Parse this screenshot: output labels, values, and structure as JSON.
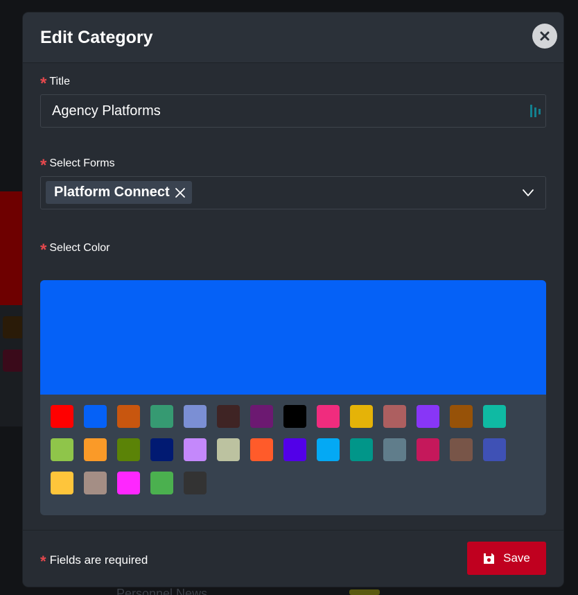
{
  "modal": {
    "title": "Edit Category"
  },
  "icons": {
    "close": "close-icon",
    "required": "asterisk",
    "password_manager": "lastpass-icon",
    "dropdown": "chevron-down-icon",
    "tag_remove": "x-icon",
    "save": "floppy-disk-icon"
  },
  "form": {
    "required_mark": "*",
    "title": {
      "label": "Title",
      "value": "Agency Platforms"
    },
    "forms": {
      "label": "Select Forms",
      "selected": [
        "Platform Connect"
      ]
    },
    "color": {
      "label": "Select Color",
      "selected": "#0561f7",
      "swatches": [
        "#ff0000",
        "#0561f7",
        "#c8560f",
        "#369a72",
        "#7b8fd4",
        "#3f2424",
        "#6c1971",
        "#000000",
        "#f02c7e",
        "#e5b308",
        "#ad5f60",
        "#8836f7",
        "#975208",
        "#0fbaa3",
        "#8fc54a",
        "#fa9a28",
        "#5b8307",
        "#011a72",
        "#c488fb",
        "#bcc2a0",
        "#ff5b2a",
        "#5200e8",
        "#04a9f4",
        "#019689",
        "#607d8b",
        "#c5185b",
        "#785548",
        "#3f51b5",
        "#fec53b",
        "#a48e85",
        "#fe27fe",
        "#4bb04f",
        "#333333"
      ]
    }
  },
  "footer": {
    "required_note": "Fields are required",
    "save_label": "Save"
  },
  "background": {
    "partial_text": "Personnel News"
  }
}
